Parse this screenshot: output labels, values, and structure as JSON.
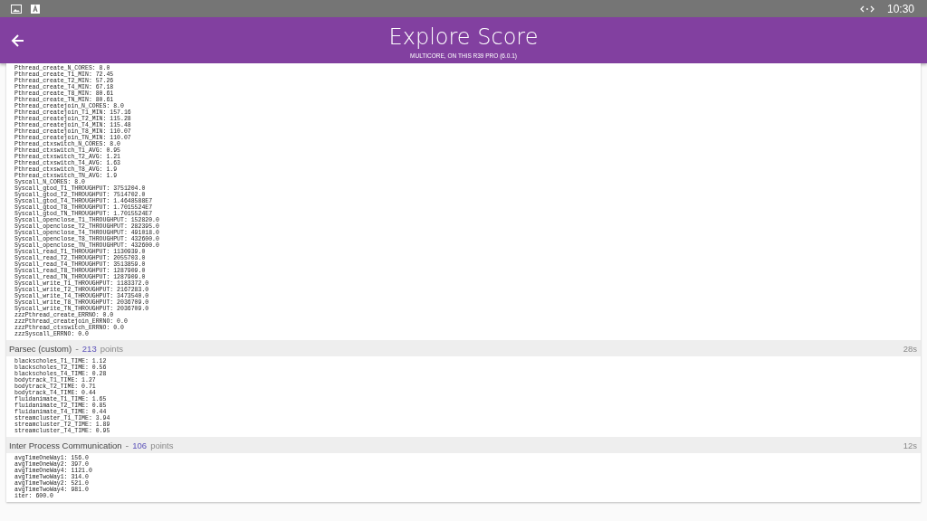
{
  "status_bar": {
    "time": "10:30"
  },
  "app_bar": {
    "title": "Explore Score",
    "subtitle": "MULTICORE, ON THIS R39 PRO (6.0.1)"
  },
  "sections": [
    {
      "lines": [
        "Pthread_create_N_CORES: 8.0",
        "Pthread_create_T1_MIN: 72.45",
        "Pthread_create_T2_MIN: 57.26",
        "Pthread_create_T4_MIN: 67.18",
        "Pthread_create_T8_MIN: 80.61",
        "Pthread_create_TN_MIN: 80.61",
        "Pthread_createjoin_N_CORES: 8.0",
        "Pthread_createjoin_T1_MIN: 157.16",
        "Pthread_createjoin_T2_MIN: 115.28",
        "Pthread_createjoin_T4_MIN: 115.48",
        "Pthread_createjoin_T8_MIN: 110.07",
        "Pthread_createjoin_TN_MIN: 110.07",
        "Pthread_ctxswitch_N_CORES: 8.0",
        "Pthread_ctxswitch_T1_AVG: 0.95",
        "Pthread_ctxswitch_T2_AVG: 1.21",
        "Pthread_ctxswitch_T4_AVG: 1.63",
        "Pthread_ctxswitch_T8_AVG: 1.9",
        "Pthread_ctxswitch_TN_AVG: 1.9",
        "Syscall_N_CORES: 8.0",
        "Syscall_gtod_T1_THROUGHPUT: 3751204.0",
        "Syscall_gtod_T2_THROUGHPUT: 7514702.0",
        "Syscall_gtod_T4_THROUGHPUT: 1.4648588E7",
        "Syscall_gtod_T8_THROUGHPUT: 1.7015524E7",
        "Syscall_gtod_TN_THROUGHPUT: 1.7015524E7",
        "Syscall_openclose_T1_THROUGHPUT: 152820.0",
        "Syscall_openclose_T2_THROUGHPUT: 282395.0",
        "Syscall_openclose_T4_THROUGHPUT: 491018.0",
        "Syscall_openclose_T8_THROUGHPUT: 432600.0",
        "Syscall_openclose_TN_THROUGHPUT: 432600.0",
        "Syscall_read_T1_THROUGHPUT: 1130939.0",
        "Syscall_read_T2_THROUGHPUT: 2055703.0",
        "Syscall_read_T4_THROUGHPUT: 3513859.0",
        "Syscall_read_T8_THROUGHPUT: 1287909.0",
        "Syscall_read_TN_THROUGHPUT: 1287909.0",
        "Syscall_write_T1_THROUGHPUT: 1183372.0",
        "Syscall_write_T2_THROUGHPUT: 2167283.0",
        "Syscall_write_T4_THROUGHPUT: 3473540.0",
        "Syscall_write_T8_THROUGHPUT: 2036709.0",
        "Syscall_write_TN_THROUGHPUT: 2036709.0",
        "zzzPthread_create_ERRNO: 0.0",
        "zzzPthread_createjoin_ERRNO: 0.0",
        "zzzPthread_ctxswitch_ERRNO: 0.0",
        "zzzSyscall_ERRNO: 0.0"
      ]
    },
    {
      "title": "Parsec (custom)",
      "separator": "-",
      "points": "213",
      "points_label": "points",
      "duration": "28s",
      "lines": [
        "blackscholes_T1_TIME: 1.12",
        "blackscholes_T2_TIME: 0.56",
        "blackscholes_T4_TIME: 0.28",
        "bodytrack_T1_TIME: 1.27",
        "bodytrack_T2_TIME: 0.71",
        "bodytrack_T4_TIME: 0.44",
        "fluidanimate_T1_TIME: 1.65",
        "fluidanimate_T2_TIME: 0.85",
        "fluidanimate_T4_TIME: 0.44",
        "streamcluster_T1_TIME: 3.94",
        "streamcluster_T2_TIME: 1.89",
        "streamcluster_T4_TIME: 0.95"
      ]
    },
    {
      "title": "Inter Process Communication",
      "separator": "-",
      "points": "106",
      "points_label": "points",
      "duration": "12s",
      "lines": [
        "avgTimeOneWay1: 156.0",
        "avgTimeOneWay2: 397.0",
        "avgTimeOneWay4: 1121.0",
        "avgTimeTwoWay1: 314.0",
        "avgTimeTwoWay2: 521.0",
        "avgTimeTwoWay4: 981.0",
        "iter: 600.0"
      ]
    }
  ]
}
